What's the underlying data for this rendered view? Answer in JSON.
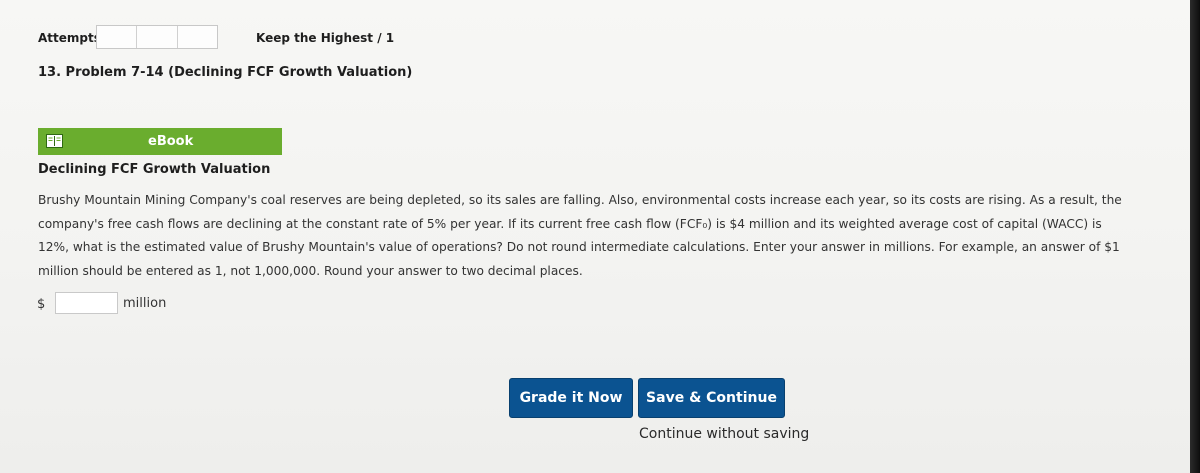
{
  "attempts": {
    "label": "Attempts",
    "box_count": 3,
    "keep_highest": "Keep the Highest / 1"
  },
  "problem": {
    "title": "13. Problem 7-14 (Declining FCF Growth Valuation)"
  },
  "ebook": {
    "icon": "book-icon",
    "label": "eBook",
    "bar_color": "#6aad2e"
  },
  "section": {
    "heading": "Declining FCF Growth Valuation",
    "text_lines": [
      "Brushy Mountain Mining Company's coal reserves are being depleted, so its sales are falling. Also, environmental costs increase each year, so its costs are rising. As a result, the",
      "company's free cash flows are declining at the constant rate of 5% per year. If its current free cash flow (FCF₀) is $4 million and its weighted average cost of capital (WACC) is",
      "12%, what is the estimated value of Brushy Mountain's value of operations? Do not round intermediate calculations. Enter your answer in millions. For example, an answer of $1",
      "million should be entered as 1, not 1,000,000. Round your answer to two decimal places."
    ]
  },
  "answer": {
    "currency": "$",
    "value": "",
    "unit": "million"
  },
  "actions": {
    "grade_label": "Grade it Now",
    "save_label": "Save & Continue",
    "continue_label": "Continue without saving",
    "button_color": "#0b5391"
  }
}
